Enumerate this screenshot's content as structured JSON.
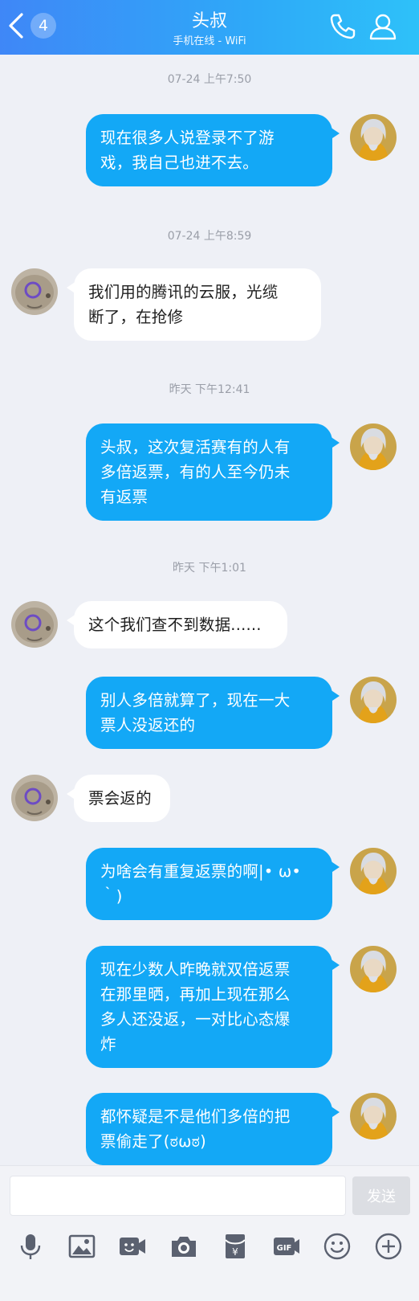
{
  "header": {
    "back_badge": "4",
    "title": "头叔",
    "subtitle": "手机在线 - WiFi",
    "gradient_start": "#3f87f7",
    "gradient_end": "#2ec1f9",
    "icons": [
      "back-chevron-icon",
      "phone-icon",
      "profile-icon"
    ]
  },
  "chat": {
    "timestamps": [
      "07-24 上午7:50",
      "07-24 上午8:59",
      "昨天 下午12:41",
      "昨天 下午1:01"
    ],
    "messages": [
      {
        "from": "me",
        "lines": [
          "现在很多人说登录不了游",
          "戏，我自己也进不去。"
        ]
      },
      {
        "from": "them",
        "lines": [
          "我们用的腾讯的云服，光缆",
          "断了，在抢修"
        ]
      },
      {
        "from": "me",
        "lines": [
          "头叔，这次复活赛有的人有",
          "多倍返票，有的人至今仍未",
          "有返票"
        ]
      },
      {
        "from": "them",
        "lines": [
          "这个我们查不到数据......"
        ]
      },
      {
        "from": "me",
        "lines": [
          "别人多倍就算了，现在一大",
          "票人没返还的"
        ]
      },
      {
        "from": "them",
        "lines": [
          "票会返的"
        ]
      },
      {
        "from": "me",
        "lines": [
          "为啥会有重复返票的啊|• ω•",
          "｀)"
        ]
      },
      {
        "from": "me",
        "lines": [
          "现在少数人昨晚就双倍返票",
          "在那里晒，再加上现在那么",
          "多人还没返，一对比心态爆",
          "炸"
        ]
      },
      {
        "from": "me",
        "lines": [
          "都怀疑是不是他们多倍的把",
          "票偷走了(ಠωಠ)"
        ]
      }
    ],
    "out_bubble_color": "#13a8f6",
    "in_bubble_color": "#ffffff"
  },
  "input": {
    "value": "",
    "send_label": "发送",
    "toolbar_icons": [
      "microphone-icon",
      "image-icon",
      "video-call-icon",
      "camera-icon",
      "red-packet-icon",
      "gif-icon",
      "emoji-icon",
      "plus-icon"
    ]
  }
}
